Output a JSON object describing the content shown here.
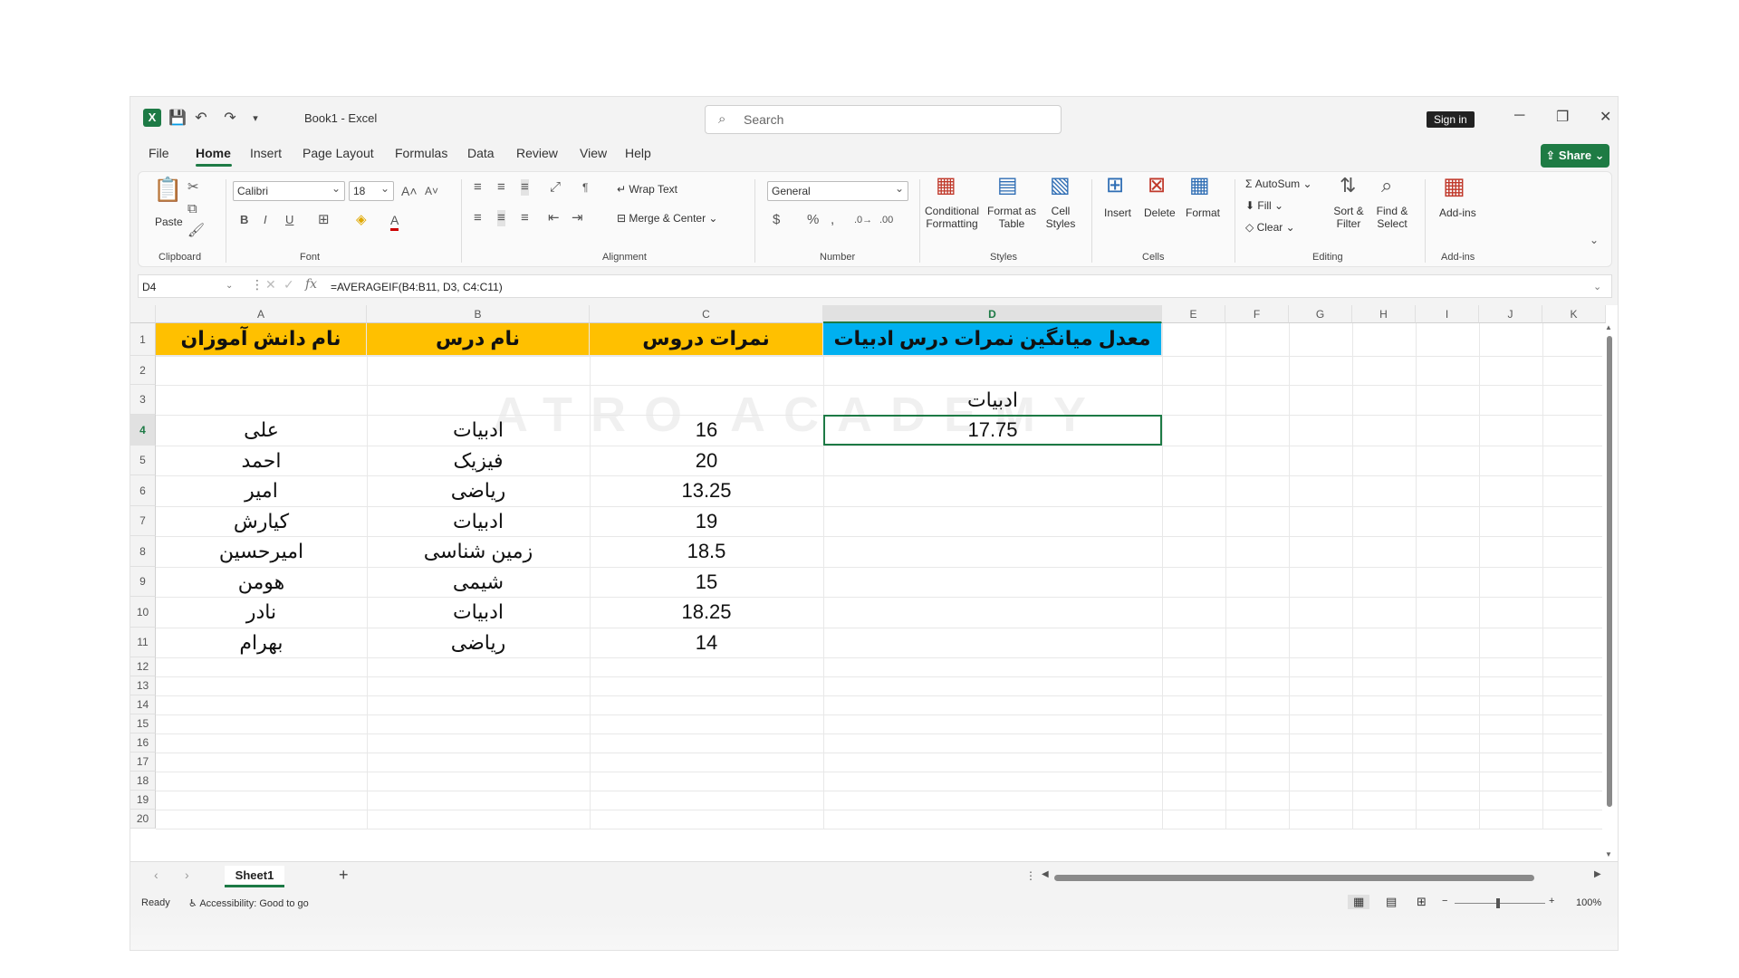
{
  "titlebar": {
    "doc_title": "Book1  -  Excel",
    "search_placeholder": "Search",
    "signin_label": "Sign in"
  },
  "menu": {
    "items": [
      "File",
      "Home",
      "Insert",
      "Page Layout",
      "Formulas",
      "Data",
      "Review",
      "View",
      "Help"
    ],
    "active": "Home",
    "share_label": "Share"
  },
  "ribbon": {
    "clipboard": {
      "paste": "Paste",
      "group": "Clipboard"
    },
    "font": {
      "name": "Calibri",
      "size": "18",
      "group": "Font"
    },
    "alignment": {
      "wrap": "Wrap Text",
      "merge": "Merge & Center",
      "group": "Alignment"
    },
    "number": {
      "format": "General",
      "group": "Number"
    },
    "styles": {
      "conditional": "Conditional Formatting",
      "format_table": "Format as Table",
      "cell_styles": "Cell Styles",
      "group": "Styles"
    },
    "cells": {
      "insert": "Insert",
      "delete": "Delete",
      "format": "Format",
      "group": "Cells"
    },
    "editing": {
      "autosum": "AutoSum",
      "fill": "Fill",
      "clear": "Clear",
      "sort": "Sort & Filter",
      "find": "Find & Select",
      "group": "Editing"
    },
    "addins": {
      "label": "Add-ins",
      "group": "Add-ins"
    }
  },
  "formula_bar": {
    "name_box": "D4",
    "formula": "=AVERAGEIF(B4:B11, D3, C4:C11)"
  },
  "columns": [
    "A",
    "B",
    "C",
    "D",
    "E",
    "F",
    "G",
    "H",
    "I",
    "J",
    "K"
  ],
  "rows": [
    "1",
    "2",
    "3",
    "4",
    "5",
    "6",
    "7",
    "8",
    "9",
    "10",
    "11",
    "12",
    "13",
    "14",
    "15",
    "16",
    "17",
    "18",
    "19",
    "20"
  ],
  "headers": {
    "A1": "نام دانش آموزان",
    "B1": "نام درس",
    "C1": "نمرات دروس",
    "D1": "معدل میانگین نمرات درس ادبیات"
  },
  "criteria": {
    "D3": "ادبیات"
  },
  "result": {
    "D4": "17.75"
  },
  "data_rows": [
    {
      "student": "علی",
      "subject": "ادبیات",
      "score": "16"
    },
    {
      "student": "احمد",
      "subject": "فیزیک",
      "score": "20"
    },
    {
      "student": "امیر",
      "subject": "ریاضی",
      "score": "13.25"
    },
    {
      "student": "کیارش",
      "subject": "ادبیات",
      "score": "19"
    },
    {
      "student": "امیرحسین",
      "subject": "زمین شناسی",
      "score": "18.5"
    },
    {
      "student": "هومن",
      "subject": "شیمی",
      "score": "15"
    },
    {
      "student": "نادر",
      "subject": "ادبیات",
      "score": "18.25"
    },
    {
      "student": "بهرام",
      "subject": "ریاضی",
      "score": "14"
    }
  ],
  "sheet": {
    "tab": "Sheet1"
  },
  "status": {
    "ready": "Ready",
    "accessibility": "Accessibility: Good to go",
    "zoom": "100%"
  },
  "watermark": "ATRO ACADEMY",
  "colors": {
    "orange": "#ffc000",
    "blue": "#00b0f0",
    "accent": "#1d7a45"
  }
}
